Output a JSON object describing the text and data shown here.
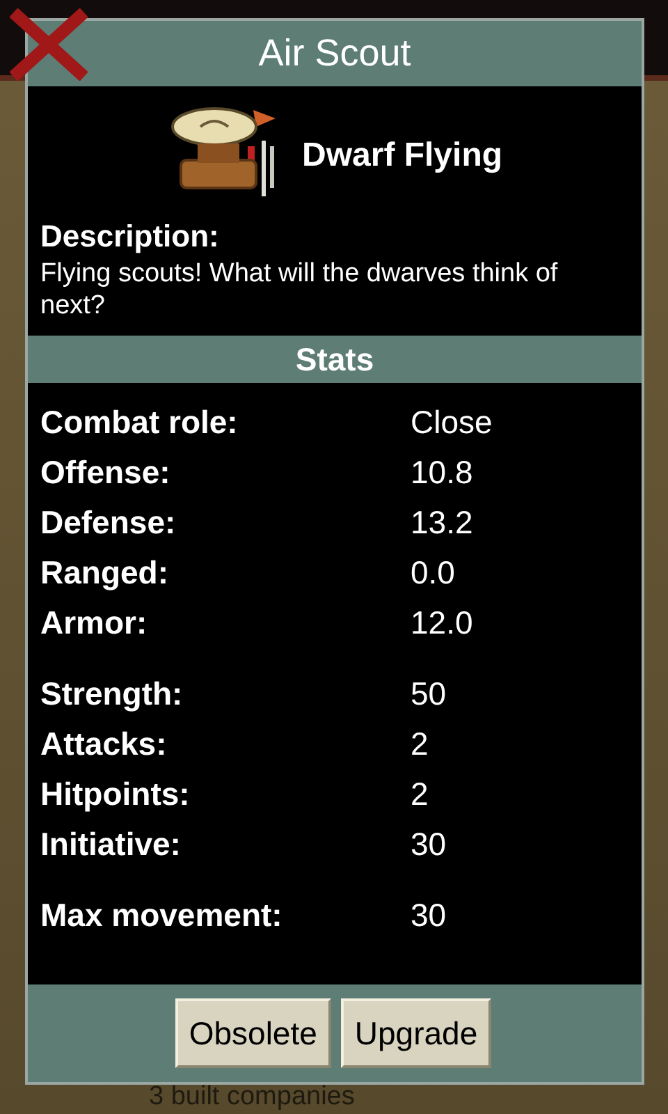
{
  "dialog": {
    "title": "Air Scout",
    "unit_name": "Dwarf Flying",
    "description_heading": "Description:",
    "description": "Flying scouts! What will the dwarves think of next?",
    "stats_heading": "Stats",
    "stat_groups": [
      {
        "rows": [
          {
            "label": "Combat role:",
            "value": "Close"
          },
          {
            "label": "Offense:",
            "value": "10.8"
          },
          {
            "label": "Defense:",
            "value": "13.2"
          },
          {
            "label": "Ranged:",
            "value": "0.0"
          },
          {
            "label": "Armor:",
            "value": "12.0"
          }
        ]
      },
      {
        "rows": [
          {
            "label": "Strength:",
            "value": "50"
          },
          {
            "label": "Attacks:",
            "value": "2"
          },
          {
            "label": "Hitpoints:",
            "value": "2"
          },
          {
            "label": "Initiative:",
            "value": "30"
          }
        ]
      },
      {
        "rows": [
          {
            "label": "Max movement:",
            "value": "30"
          }
        ]
      }
    ],
    "buttons": [
      "Obsolete",
      "Upgrade"
    ]
  },
  "background": {
    "list_item_caption": "3 built companies"
  }
}
